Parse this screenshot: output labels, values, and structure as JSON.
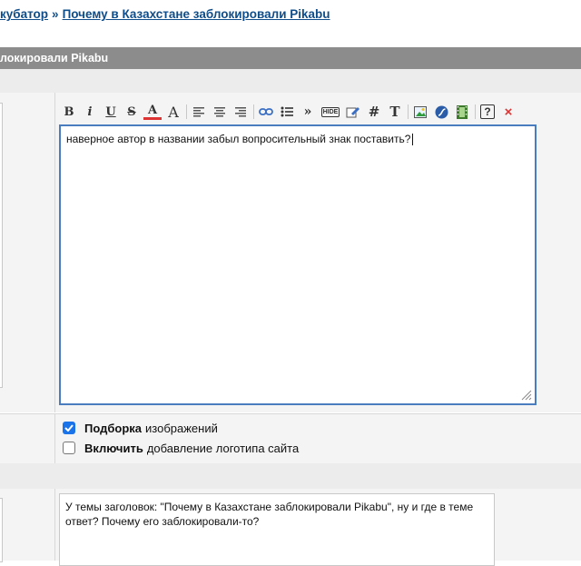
{
  "breadcrumb": {
    "parent_label": "кубатор",
    "separator": "»",
    "current_label": "Почему в Казахстане заблокировали Pikabu"
  },
  "title_bar": {
    "text": "локировали Pikabu"
  },
  "toolbar": {
    "buttons": [
      {
        "label": "B",
        "icon": "bold-icon"
      },
      {
        "label": "i",
        "icon": "italic-icon"
      },
      {
        "label": "U",
        "icon": "underline-icon"
      },
      {
        "label": "S",
        "icon": "strikethrough-icon"
      },
      {
        "label": "A",
        "icon": "font-color-icon"
      },
      {
        "label": "A",
        "icon": "font-size-icon"
      },
      {
        "label": "",
        "icon": "align-left-icon"
      },
      {
        "label": "",
        "icon": "align-center-icon"
      },
      {
        "label": "",
        "icon": "align-right-icon"
      },
      {
        "label": "",
        "icon": "link-icon"
      },
      {
        "label": "",
        "icon": "list-icon"
      },
      {
        "label": "»",
        "icon": "quote-icon"
      },
      {
        "label": "HIDE",
        "icon": "hide-icon"
      },
      {
        "label": "",
        "icon": "edit-icon"
      },
      {
        "label": "#",
        "icon": "code-icon"
      },
      {
        "label": "T",
        "icon": "text-icon"
      },
      {
        "label": "",
        "icon": "image-icon"
      },
      {
        "label": "",
        "icon": "flash-icon"
      },
      {
        "label": "",
        "icon": "video-icon"
      },
      {
        "label": "?",
        "icon": "help-icon"
      },
      {
        "label": "×",
        "icon": "close-icon"
      }
    ]
  },
  "editor": {
    "text": "наверное автор в названии забыл вопросительный знак поставить?"
  },
  "options": {
    "pick_images": {
      "bold": "Подборка",
      "rest": "изображений",
      "checked": true
    },
    "logo": {
      "bold": "Включить",
      "rest": "добавление логотипа сайта",
      "checked": false
    }
  },
  "comment": {
    "text": "У темы заголовок: \"Почему в Казахстане заблокировали Pikabu\", ну и где в теме ответ? Почему его заблокировали-то?"
  },
  "colors": {
    "link": "#0f4d8a",
    "title_bar": "#8c8c8c",
    "editor_border": "#4a7dbf",
    "checkbox_checked": "#1a73e8",
    "close_red": "#d33"
  }
}
